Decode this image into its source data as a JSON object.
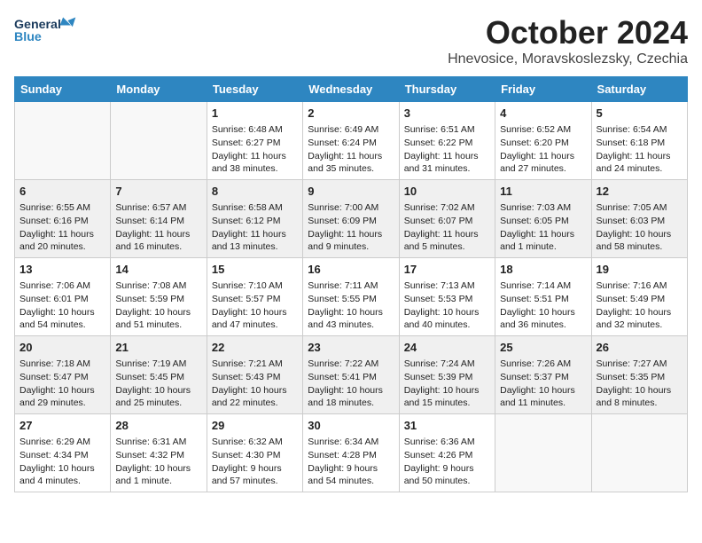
{
  "header": {
    "logo_line1": "General",
    "logo_line2": "Blue",
    "month": "October 2024",
    "location": "Hnevosice, Moravskoslezsky, Czechia"
  },
  "weekdays": [
    "Sunday",
    "Monday",
    "Tuesday",
    "Wednesday",
    "Thursday",
    "Friday",
    "Saturday"
  ],
  "weeks": [
    [
      {
        "day": "",
        "sunrise": "",
        "sunset": "",
        "daylight": ""
      },
      {
        "day": "",
        "sunrise": "",
        "sunset": "",
        "daylight": ""
      },
      {
        "day": "1",
        "sunrise": "Sunrise: 6:48 AM",
        "sunset": "Sunset: 6:27 PM",
        "daylight": "Daylight: 11 hours and 38 minutes."
      },
      {
        "day": "2",
        "sunrise": "Sunrise: 6:49 AM",
        "sunset": "Sunset: 6:24 PM",
        "daylight": "Daylight: 11 hours and 35 minutes."
      },
      {
        "day": "3",
        "sunrise": "Sunrise: 6:51 AM",
        "sunset": "Sunset: 6:22 PM",
        "daylight": "Daylight: 11 hours and 31 minutes."
      },
      {
        "day": "4",
        "sunrise": "Sunrise: 6:52 AM",
        "sunset": "Sunset: 6:20 PM",
        "daylight": "Daylight: 11 hours and 27 minutes."
      },
      {
        "day": "5",
        "sunrise": "Sunrise: 6:54 AM",
        "sunset": "Sunset: 6:18 PM",
        "daylight": "Daylight: 11 hours and 24 minutes."
      }
    ],
    [
      {
        "day": "6",
        "sunrise": "Sunrise: 6:55 AM",
        "sunset": "Sunset: 6:16 PM",
        "daylight": "Daylight: 11 hours and 20 minutes."
      },
      {
        "day": "7",
        "sunrise": "Sunrise: 6:57 AM",
        "sunset": "Sunset: 6:14 PM",
        "daylight": "Daylight: 11 hours and 16 minutes."
      },
      {
        "day": "8",
        "sunrise": "Sunrise: 6:58 AM",
        "sunset": "Sunset: 6:12 PM",
        "daylight": "Daylight: 11 hours and 13 minutes."
      },
      {
        "day": "9",
        "sunrise": "Sunrise: 7:00 AM",
        "sunset": "Sunset: 6:09 PM",
        "daylight": "Daylight: 11 hours and 9 minutes."
      },
      {
        "day": "10",
        "sunrise": "Sunrise: 7:02 AM",
        "sunset": "Sunset: 6:07 PM",
        "daylight": "Daylight: 11 hours and 5 minutes."
      },
      {
        "day": "11",
        "sunrise": "Sunrise: 7:03 AM",
        "sunset": "Sunset: 6:05 PM",
        "daylight": "Daylight: 11 hours and 1 minute."
      },
      {
        "day": "12",
        "sunrise": "Sunrise: 7:05 AM",
        "sunset": "Sunset: 6:03 PM",
        "daylight": "Daylight: 10 hours and 58 minutes."
      }
    ],
    [
      {
        "day": "13",
        "sunrise": "Sunrise: 7:06 AM",
        "sunset": "Sunset: 6:01 PM",
        "daylight": "Daylight: 10 hours and 54 minutes."
      },
      {
        "day": "14",
        "sunrise": "Sunrise: 7:08 AM",
        "sunset": "Sunset: 5:59 PM",
        "daylight": "Daylight: 10 hours and 51 minutes."
      },
      {
        "day": "15",
        "sunrise": "Sunrise: 7:10 AM",
        "sunset": "Sunset: 5:57 PM",
        "daylight": "Daylight: 10 hours and 47 minutes."
      },
      {
        "day": "16",
        "sunrise": "Sunrise: 7:11 AM",
        "sunset": "Sunset: 5:55 PM",
        "daylight": "Daylight: 10 hours and 43 minutes."
      },
      {
        "day": "17",
        "sunrise": "Sunrise: 7:13 AM",
        "sunset": "Sunset: 5:53 PM",
        "daylight": "Daylight: 10 hours and 40 minutes."
      },
      {
        "day": "18",
        "sunrise": "Sunrise: 7:14 AM",
        "sunset": "Sunset: 5:51 PM",
        "daylight": "Daylight: 10 hours and 36 minutes."
      },
      {
        "day": "19",
        "sunrise": "Sunrise: 7:16 AM",
        "sunset": "Sunset: 5:49 PM",
        "daylight": "Daylight: 10 hours and 32 minutes."
      }
    ],
    [
      {
        "day": "20",
        "sunrise": "Sunrise: 7:18 AM",
        "sunset": "Sunset: 5:47 PM",
        "daylight": "Daylight: 10 hours and 29 minutes."
      },
      {
        "day": "21",
        "sunrise": "Sunrise: 7:19 AM",
        "sunset": "Sunset: 5:45 PM",
        "daylight": "Daylight: 10 hours and 25 minutes."
      },
      {
        "day": "22",
        "sunrise": "Sunrise: 7:21 AM",
        "sunset": "Sunset: 5:43 PM",
        "daylight": "Daylight: 10 hours and 22 minutes."
      },
      {
        "day": "23",
        "sunrise": "Sunrise: 7:22 AM",
        "sunset": "Sunset: 5:41 PM",
        "daylight": "Daylight: 10 hours and 18 minutes."
      },
      {
        "day": "24",
        "sunrise": "Sunrise: 7:24 AM",
        "sunset": "Sunset: 5:39 PM",
        "daylight": "Daylight: 10 hours and 15 minutes."
      },
      {
        "day": "25",
        "sunrise": "Sunrise: 7:26 AM",
        "sunset": "Sunset: 5:37 PM",
        "daylight": "Daylight: 10 hours and 11 minutes."
      },
      {
        "day": "26",
        "sunrise": "Sunrise: 7:27 AM",
        "sunset": "Sunset: 5:35 PM",
        "daylight": "Daylight: 10 hours and 8 minutes."
      }
    ],
    [
      {
        "day": "27",
        "sunrise": "Sunrise: 6:29 AM",
        "sunset": "Sunset: 4:34 PM",
        "daylight": "Daylight: 10 hours and 4 minutes."
      },
      {
        "day": "28",
        "sunrise": "Sunrise: 6:31 AM",
        "sunset": "Sunset: 4:32 PM",
        "daylight": "Daylight: 10 hours and 1 minute."
      },
      {
        "day": "29",
        "sunrise": "Sunrise: 6:32 AM",
        "sunset": "Sunset: 4:30 PM",
        "daylight": "Daylight: 9 hours and 57 minutes."
      },
      {
        "day": "30",
        "sunrise": "Sunrise: 6:34 AM",
        "sunset": "Sunset: 4:28 PM",
        "daylight": "Daylight: 9 hours and 54 minutes."
      },
      {
        "day": "31",
        "sunrise": "Sunrise: 6:36 AM",
        "sunset": "Sunset: 4:26 PM",
        "daylight": "Daylight: 9 hours and 50 minutes."
      },
      {
        "day": "",
        "sunrise": "",
        "sunset": "",
        "daylight": ""
      },
      {
        "day": "",
        "sunrise": "",
        "sunset": "",
        "daylight": ""
      }
    ]
  ]
}
